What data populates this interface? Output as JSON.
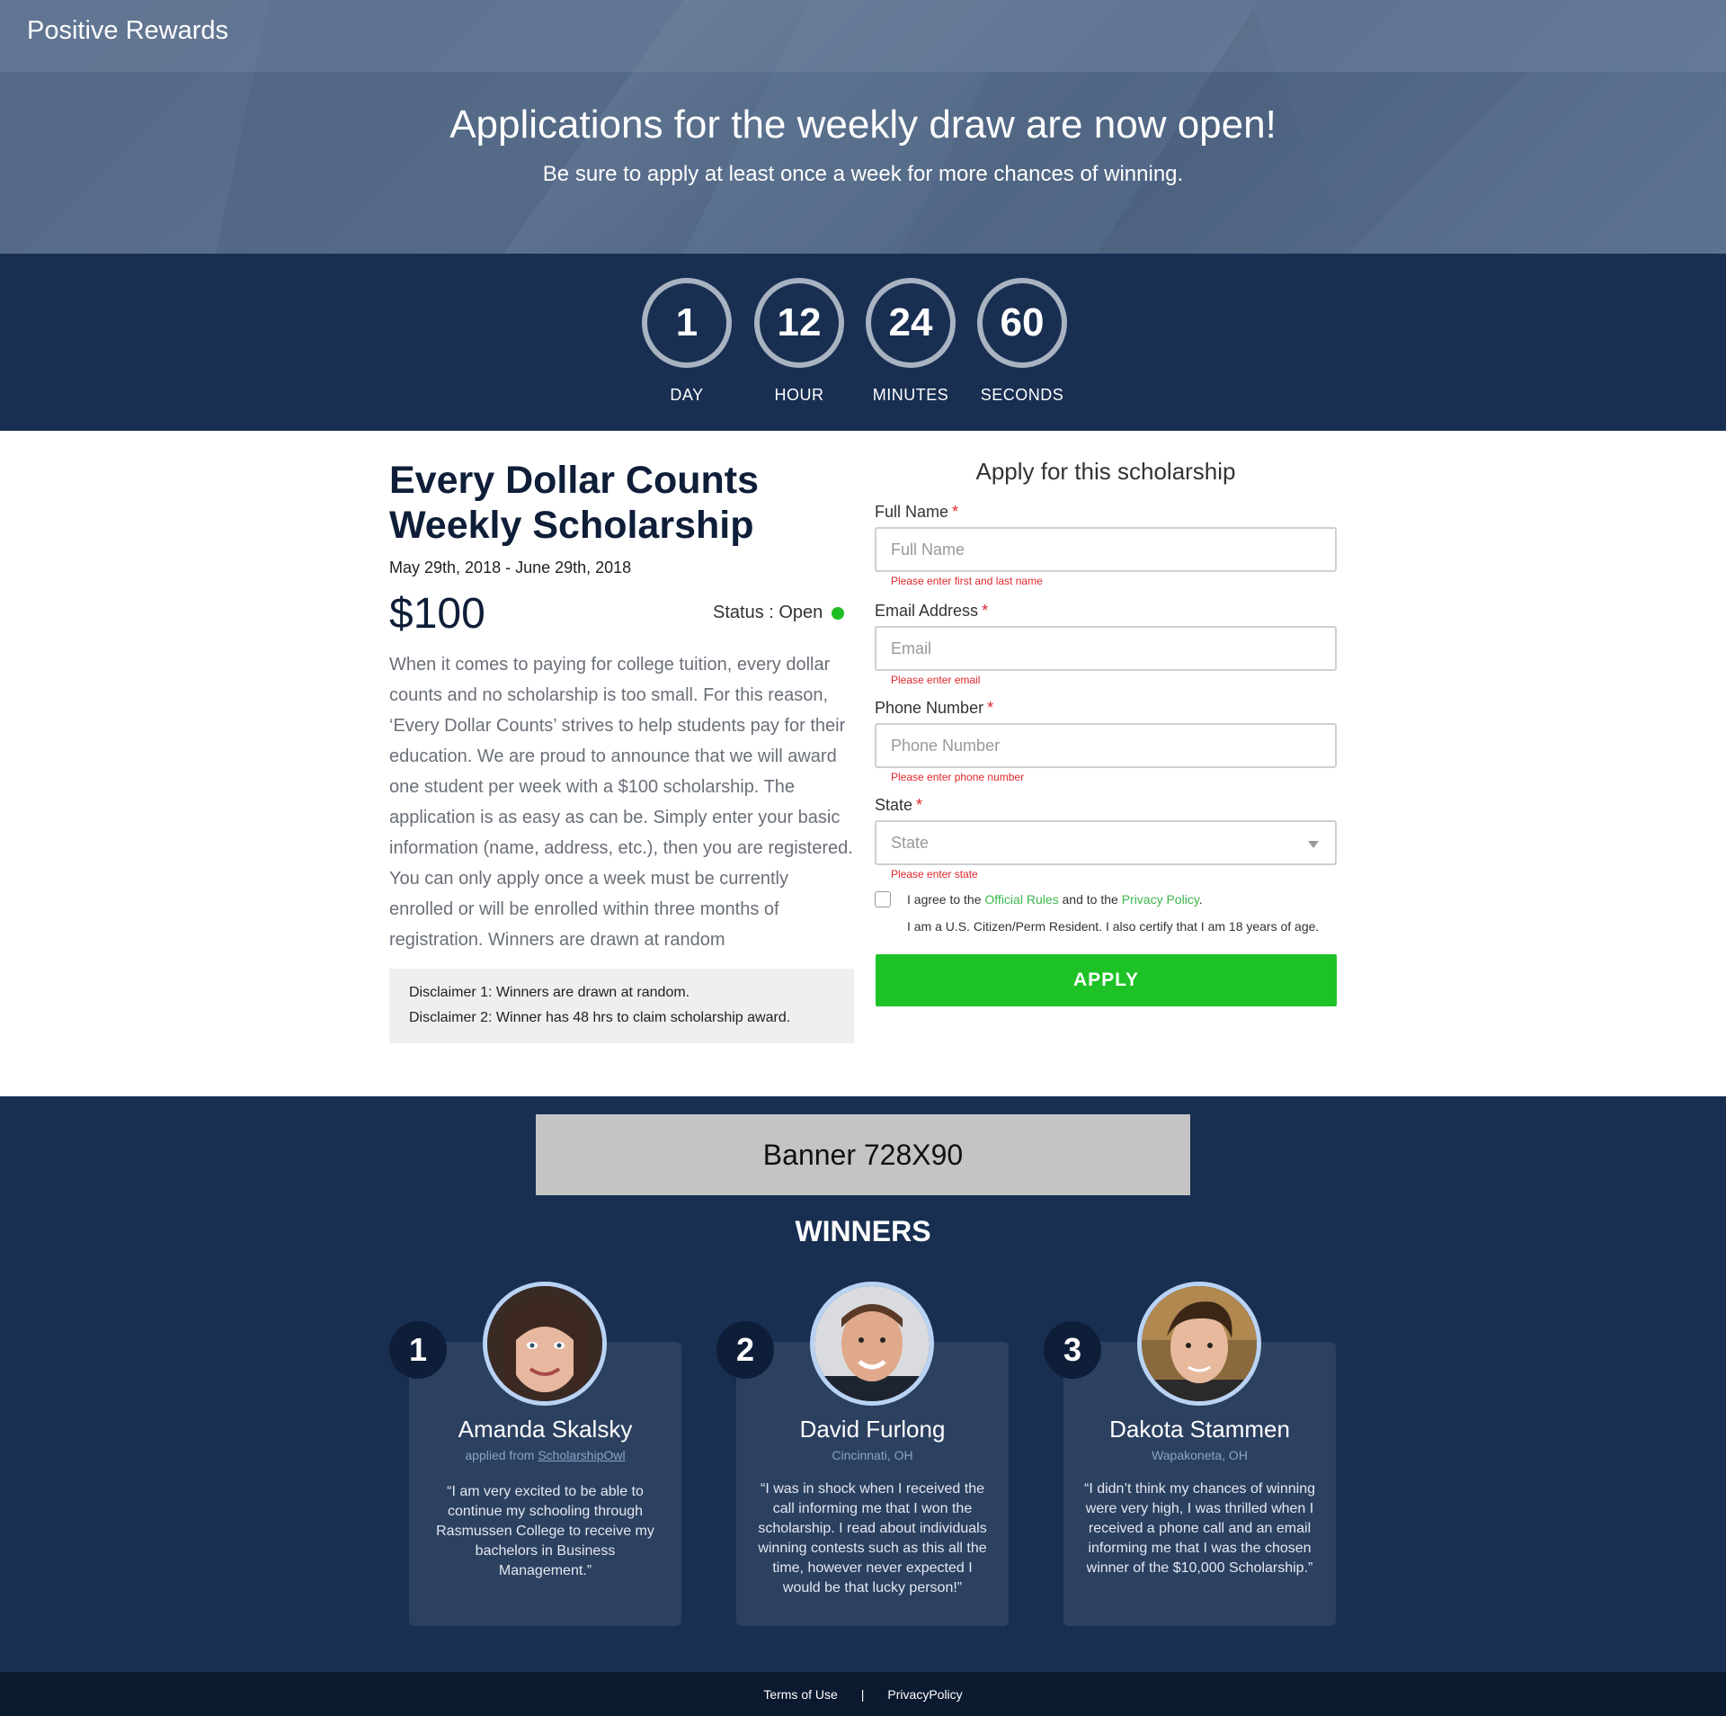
{
  "header": {
    "brand": "Positive Rewards",
    "title": "Applications for the weekly draw are now open!",
    "subtitle": "Be sure to apply at least once a week for more chances of winning."
  },
  "countdown": {
    "units": [
      {
        "value": "1",
        "label": "DAY"
      },
      {
        "value": "12",
        "label": "HOUR"
      },
      {
        "value": "24",
        "label": "MINUTES"
      },
      {
        "value": "60",
        "label": "SECONDS"
      }
    ]
  },
  "scholarship": {
    "title": "Every Dollar Counts Weekly Scholarship",
    "dates": "May 29th, 2018 - June 29th, 2018",
    "amount": "$100",
    "status": "Status : Open",
    "status_color": "#1dbf25",
    "description": "When it comes to paying for college tuition, every dollar counts and no scholarship is too small. For this reason, ‘Every Dollar Counts’ strives to help students pay for their education. We are proud to announce that we will award one student per week with a $100 scholarship. The application is as easy as can be. Simply enter your basic information (name, address, etc.), then you are registered. You can only apply once a week must be currently enrolled or will be enrolled within three months of registration. Winners are drawn at random",
    "disclaimers": [
      "Disclaimer 1: Winners are drawn at random.",
      "Disclaimer 2: Winner has 48 hrs to claim scholarship award."
    ]
  },
  "form": {
    "title": "Apply for this scholarship",
    "required_mark": "*",
    "full_name": {
      "label": "Full Name",
      "placeholder": "Full Name",
      "error": "Please enter first and last name"
    },
    "email": {
      "label": "Email Address",
      "placeholder": "Email",
      "error": "Please enter email"
    },
    "phone": {
      "label": "Phone Number",
      "placeholder": "Phone Number",
      "error": "Please enter phone number"
    },
    "state": {
      "label": "State",
      "value": "State",
      "error": "Please enter state"
    },
    "agree": {
      "prefix": "I agree to the ",
      "rules_link": "Official Rules",
      "middle": " and to the ",
      "privacy_link": "Privacy Policy",
      "suffix": ".",
      "line2": "I am a U.S. Citizen/Perm Resident.  I also certify that I am 18 years of age."
    },
    "apply_label": "APPLY",
    "apply_color": "#1dc226"
  },
  "winners": {
    "banner": "Banner 728X90",
    "title": "WINNERS",
    "items": [
      {
        "rank": "1",
        "name": "Amanda Skalsky",
        "location_prefix": "applied from ",
        "location_link": "ScholarshipOwl",
        "location": "",
        "quote": "“I am very excited to be able to continue my schooling through Rasmussen College to receive my bachelors in Business Management.”"
      },
      {
        "rank": "2",
        "name": "David Furlong",
        "location": "Cincinnati, OH",
        "quote": "“I was in shock when I received the call informing me that I won the scholarship. I read about individuals winning contests such as this all the time, however never expected I would be that lucky person!”"
      },
      {
        "rank": "3",
        "name": "Dakota Stammen",
        "location": "Wapakoneta, OH",
        "quote": "“I didn’t think my chances of winning were very high, I was thrilled when I received a phone call and an email informing me that I was the chosen winner of the $10,000 Scholarship.”"
      }
    ]
  },
  "footer": {
    "terms": "Terms of Use",
    "separator": "|",
    "privacy": "PrivacyPolicy"
  }
}
